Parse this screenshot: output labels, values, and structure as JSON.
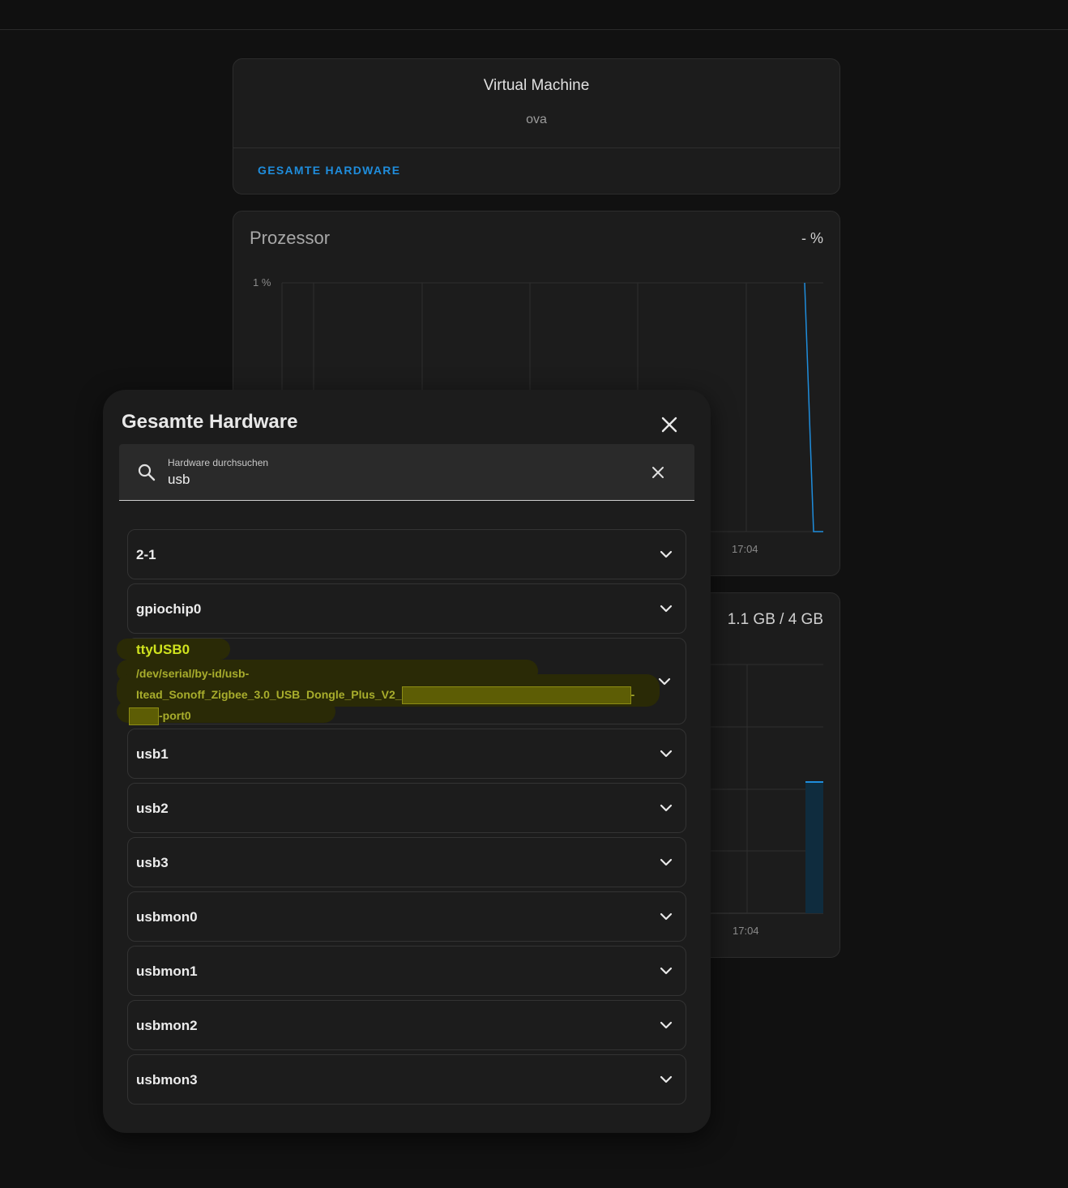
{
  "vm_card": {
    "title": "Virtual Machine",
    "subtitle": "ova",
    "link": "GESAMTE HARDWARE"
  },
  "processor_card": {
    "title": "Prozessor",
    "value": "- %",
    "ytick": "1 %",
    "xtick": "17:04"
  },
  "memory_card": {
    "value": "1.1 GB / 4 GB",
    "xtick": "17:04"
  },
  "dialog": {
    "title": "Gesamte Hardware",
    "search": {
      "label": "Hardware durchsuchen",
      "value": "usb"
    },
    "items": [
      {
        "label": "2-1"
      },
      {
        "label": "gpiochip0"
      },
      {
        "label": "ttyUSB0",
        "path_start": "/dev/serial/by-id/usb-",
        "path_mid": "Itead_Sonoff_Zigbee_3.0_USB_Dongle_Plus_V2_",
        "path_sep": "-",
        "path_end": "-port0"
      },
      {
        "label": "usb1"
      },
      {
        "label": "usb2"
      },
      {
        "label": "usb3"
      },
      {
        "label": "usbmon0"
      },
      {
        "label": "usbmon1"
      },
      {
        "label": "usbmon2"
      },
      {
        "label": "usbmon3"
      }
    ]
  },
  "colors": {
    "accent": "#1f8ddc",
    "background": "#111111",
    "card": "#1c1c1c",
    "highlight_text": "#cfe21e"
  }
}
